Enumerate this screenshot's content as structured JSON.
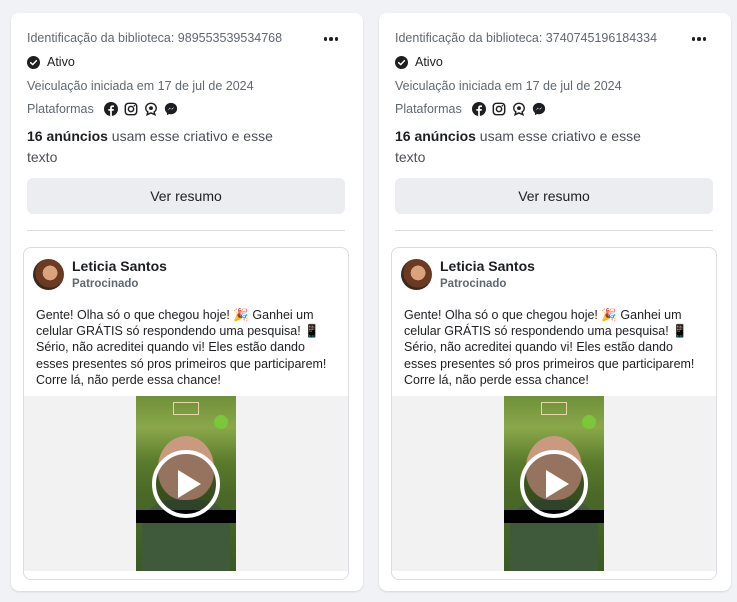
{
  "cards": [
    {
      "library_id": "Identificação da biblioteca: 989553539534768",
      "status": "Ativo",
      "started": "Veiculação iniciada em 17 de jul de 2024",
      "platforms_label": "Plataformas",
      "platform_icons": [
        "facebook-icon",
        "instagram-icon",
        "audience-network-icon",
        "messenger-icon"
      ],
      "uses_count": "16 anúncios",
      "uses_rest": " usam esse criativo e esse texto",
      "summary_button": "Ver resumo",
      "ad": {
        "page_name": "Leticia Santos",
        "sponsored": "Patrocinado",
        "text": "Gente! Olha só o que chegou hoje! 🎉 Ganhei um celular GRÁTIS só respondendo uma pesquisa! 📱 Sério, não acreditei quando vi! Eles estão dando esses presentes só pros primeiros que participarem! Corre lá, não perde essa chance!"
      }
    },
    {
      "library_id": "Identificação da biblioteca: 3740745196184334",
      "status": "Ativo",
      "started": "Veiculação iniciada em 17 de jul de 2024",
      "platforms_label": "Plataformas",
      "platform_icons": [
        "facebook-icon",
        "instagram-icon",
        "audience-network-icon",
        "messenger-icon"
      ],
      "uses_count": "16 anúncios",
      "uses_rest": " usam esse criativo e esse texto",
      "summary_button": "Ver resumo",
      "ad": {
        "page_name": "Leticia Santos",
        "sponsored": "Patrocinado",
        "text": "Gente! Olha só o que chegou hoje! 🎉 Ganhei um celular GRÁTIS só respondendo uma pesquisa! 📱 Sério, não acreditei quando vi! Eles estão dando esses presentes só pros primeiros que participarem! Corre lá, não perde essa chance!"
      }
    }
  ],
  "colors": {
    "background": "#f0f2f5",
    "card": "#ffffff",
    "button": "#ebedf0",
    "text_primary": "#1c1e21",
    "text_secondary": "#606770"
  }
}
